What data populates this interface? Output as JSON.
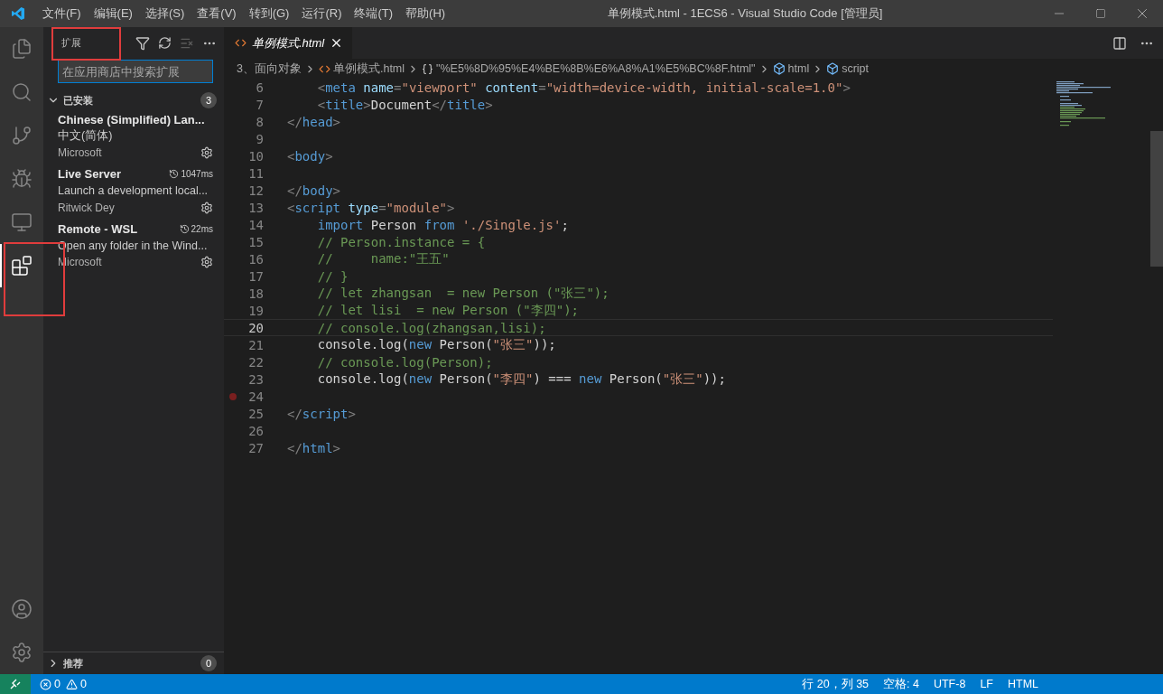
{
  "window": {
    "title": "单例模式.html - 1ECS6 - Visual Studio Code [管理员]"
  },
  "menu": [
    "文件(F)",
    "编辑(E)",
    "选择(S)",
    "查看(V)",
    "转到(G)",
    "运行(R)",
    "终端(T)",
    "帮助(H)"
  ],
  "activity_bar": [
    {
      "kind": "explorer",
      "selected": false,
      "highlighted": false
    },
    {
      "kind": "search",
      "selected": false,
      "highlighted": false
    },
    {
      "kind": "scm",
      "selected": false,
      "highlighted": false
    },
    {
      "kind": "run",
      "selected": false,
      "highlighted": false
    },
    {
      "kind": "remote",
      "selected": false,
      "highlighted": false
    },
    {
      "kind": "extensions",
      "selected": true,
      "highlighted": true
    }
  ],
  "activity_bottom": [
    {
      "kind": "account"
    },
    {
      "kind": "manage"
    }
  ],
  "sidebar": {
    "title": "扩展",
    "title_highlighted": true,
    "search": {
      "placeholder": "在应用商店中搜索扩展"
    },
    "installed": {
      "label": "已安装",
      "count": "3",
      "expanded": true,
      "items": [
        {
          "name": "Chinese (Simplified) Lan...",
          "description": "中文(简体)",
          "publisher": "Microsoft"
        },
        {
          "name": "Live Server",
          "timing": "1047ms",
          "description": "Launch a development local...",
          "publisher": "Ritwick Dey"
        },
        {
          "name": "Remote - WSL",
          "timing": "22ms",
          "description": "Open any folder in the Wind...",
          "publisher": "Microsoft"
        }
      ]
    },
    "recommended": {
      "label": "推荐",
      "count": "0",
      "expanded": false
    }
  },
  "tabs": [
    {
      "label": "单例模式.html",
      "selected": true,
      "preview": true
    }
  ],
  "breadcrumbs": [
    {
      "kind": "folder",
      "label": "3、面向对象"
    },
    {
      "kind": "file",
      "label": "单例模式.html"
    },
    {
      "kind": "braces",
      "label": "\"%E5%8D%95%E4%BE%8B%E6%A8%A1%E5%BC%8F.html\""
    },
    {
      "kind": "element",
      "label": "html"
    },
    {
      "kind": "element",
      "label": "script"
    }
  ],
  "code": [
    {
      "n": "6",
      "current": false,
      "breakpoint": false,
      "tokens": [
        {
          "kind": "punct",
          "text": "    <"
        },
        {
          "kind": "tag",
          "text": "meta"
        },
        {
          "kind": "attr",
          "text": " name"
        },
        {
          "kind": "punct",
          "text": "="
        },
        {
          "kind": "str",
          "text": "\"viewport\""
        },
        {
          "kind": "attr",
          "text": " content"
        },
        {
          "kind": "punct",
          "text": "="
        },
        {
          "kind": "str",
          "text": "\"width=device-width, initial-scale=1.0\""
        },
        {
          "kind": "punct",
          "text": ">"
        }
      ]
    },
    {
      "n": "7",
      "current": false,
      "breakpoint": false,
      "tokens": [
        {
          "kind": "punct",
          "text": "    <"
        },
        {
          "kind": "tag",
          "text": "title"
        },
        {
          "kind": "punct",
          "text": ">"
        },
        {
          "kind": "text",
          "text": "Document"
        },
        {
          "kind": "punct",
          "text": "</"
        },
        {
          "kind": "tag",
          "text": "title"
        },
        {
          "kind": "punct",
          "text": ">"
        }
      ]
    },
    {
      "n": "8",
      "current": false,
      "breakpoint": false,
      "tokens": [
        {
          "kind": "punct",
          "text": "</"
        },
        {
          "kind": "tag",
          "text": "head"
        },
        {
          "kind": "punct",
          "text": ">"
        }
      ]
    },
    {
      "n": "9",
      "current": false,
      "breakpoint": false
    },
    {
      "n": "10",
      "current": false,
      "breakpoint": false,
      "tokens": [
        {
          "kind": "punct",
          "text": "<"
        },
        {
          "kind": "tag",
          "text": "body"
        },
        {
          "kind": "punct",
          "text": ">"
        }
      ]
    },
    {
      "n": "11",
      "current": false,
      "breakpoint": false
    },
    {
      "n": "12",
      "current": false,
      "breakpoint": false,
      "tokens": [
        {
          "kind": "punct",
          "text": "</"
        },
        {
          "kind": "tag",
          "text": "body"
        },
        {
          "kind": "punct",
          "text": ">"
        }
      ]
    },
    {
      "n": "13",
      "current": false,
      "breakpoint": false,
      "tokens": [
        {
          "kind": "punct",
          "text": "<"
        },
        {
          "kind": "tag",
          "text": "script"
        },
        {
          "kind": "attr",
          "text": " type"
        },
        {
          "kind": "punct",
          "text": "="
        },
        {
          "kind": "str",
          "text": "\"module\""
        },
        {
          "kind": "punct",
          "text": ">"
        }
      ]
    },
    {
      "n": "14",
      "current": false,
      "breakpoint": false,
      "tokens": [
        {
          "kind": "kw",
          "text": "    import"
        },
        {
          "kind": "text",
          "text": " Person "
        },
        {
          "kind": "kw",
          "text": "from"
        },
        {
          "kind": "str",
          "text": " './Single.js'"
        },
        {
          "kind": "text",
          "text": ";"
        }
      ]
    },
    {
      "n": "15",
      "current": false,
      "breakpoint": false,
      "tokens": [
        {
          "kind": "comment",
          "text": "    // Person.instance = {"
        }
      ]
    },
    {
      "n": "16",
      "current": false,
      "breakpoint": false,
      "tokens": [
        {
          "kind": "comment",
          "text": "    //     name:\"王五\""
        }
      ]
    },
    {
      "n": "17",
      "current": false,
      "breakpoint": false,
      "tokens": [
        {
          "kind": "comment",
          "text": "    // }"
        }
      ]
    },
    {
      "n": "18",
      "current": false,
      "breakpoint": false,
      "tokens": [
        {
          "kind": "comment",
          "text": "    // let zhangsan  = new Person (\"张三\");"
        }
      ]
    },
    {
      "n": "19",
      "current": false,
      "breakpoint": false,
      "tokens": [
        {
          "kind": "comment",
          "text": "    // let lisi  = new Person (\"李四\");"
        }
      ]
    },
    {
      "n": "20",
      "current": true,
      "breakpoint": false,
      "tokens": [
        {
          "kind": "comment",
          "text": "    // console.log(zhangsan,lisi);"
        }
      ]
    },
    {
      "n": "21",
      "current": false,
      "breakpoint": false,
      "tokens": [
        {
          "kind": "text",
          "text": "    console.log("
        },
        {
          "kind": "kw",
          "text": "new"
        },
        {
          "kind": "text",
          "text": " Person("
        },
        {
          "kind": "str",
          "text": "\"张三\""
        },
        {
          "kind": "text",
          "text": "));"
        }
      ]
    },
    {
      "n": "22",
      "current": false,
      "breakpoint": false,
      "tokens": [
        {
          "kind": "comment",
          "text": "    // console.log(Person);"
        }
      ]
    },
    {
      "n": "23",
      "current": false,
      "breakpoint": false,
      "tokens": [
        {
          "kind": "text",
          "text": "    console.log("
        },
        {
          "kind": "kw",
          "text": "new"
        },
        {
          "kind": "text",
          "text": " Person("
        },
        {
          "kind": "str",
          "text": "\"李四\""
        },
        {
          "kind": "text",
          "text": ") === "
        },
        {
          "kind": "kw",
          "text": "new"
        },
        {
          "kind": "text",
          "text": " Person("
        },
        {
          "kind": "str",
          "text": "\"张三\""
        },
        {
          "kind": "text",
          "text": "));"
        }
      ]
    },
    {
      "n": "24",
      "current": false,
      "breakpoint": true
    },
    {
      "n": "25",
      "current": false,
      "breakpoint": false,
      "tokens": [
        {
          "kind": "punct",
          "text": "</"
        },
        {
          "kind": "tag",
          "text": "script"
        },
        {
          "kind": "punct",
          "text": ">"
        }
      ]
    },
    {
      "n": "26",
      "current": false,
      "breakpoint": false
    },
    {
      "n": "27",
      "current": false,
      "breakpoint": false,
      "tokens": [
        {
          "kind": "punct",
          "text": "</"
        },
        {
          "kind": "tag",
          "text": "html"
        },
        {
          "kind": "punct",
          "text": ">"
        }
      ]
    }
  ],
  "status_bar": {
    "errors": "0",
    "warnings": "0",
    "right": [
      "行 20，列 35",
      "空格: 4",
      "UTF-8",
      "LF",
      "HTML"
    ]
  }
}
